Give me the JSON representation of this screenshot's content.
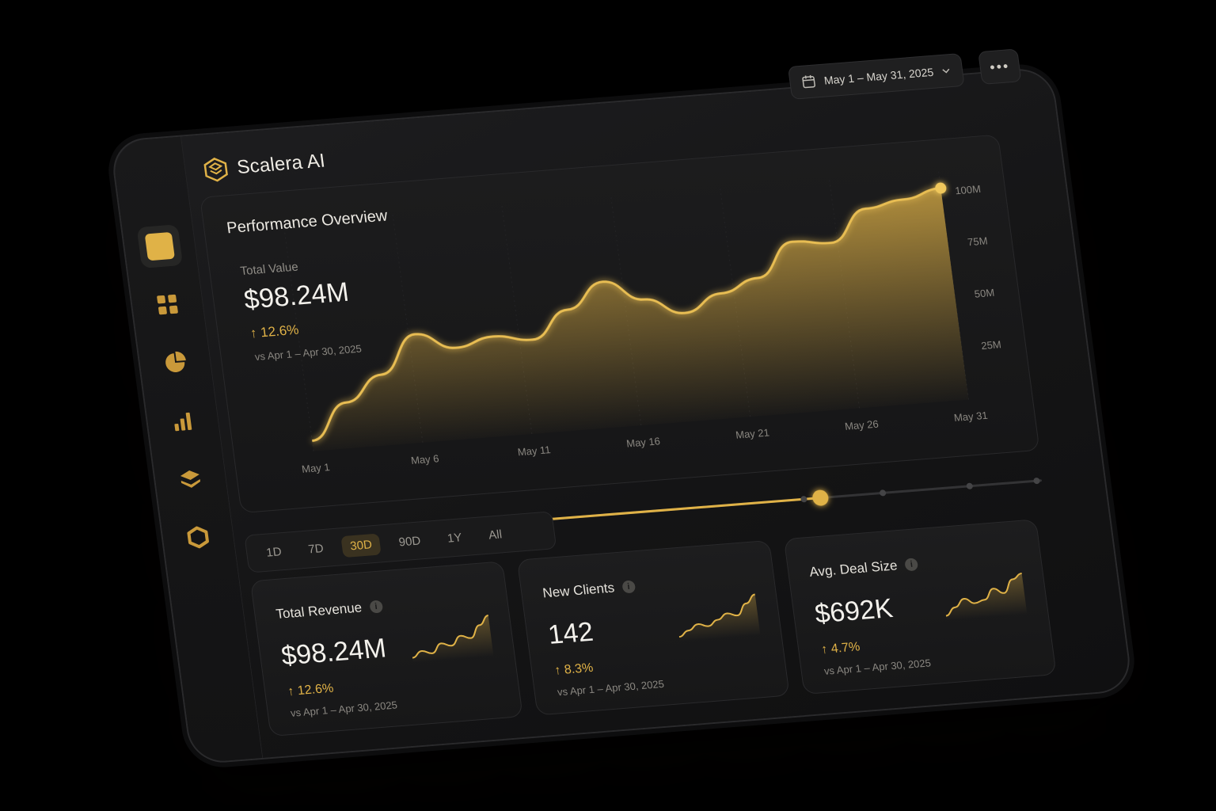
{
  "app": {
    "name": "Scalera AI"
  },
  "header": {
    "date_range": "May 1 – May 31, 2025",
    "more_label": "•••"
  },
  "sidebar": {
    "items": [
      {
        "icon": "home-square-icon",
        "active": true
      },
      {
        "icon": "grid-icon"
      },
      {
        "icon": "pie-chart-icon"
      },
      {
        "icon": "bar-chart-icon"
      },
      {
        "icon": "layers-icon"
      },
      {
        "icon": "hexagon-icon"
      }
    ]
  },
  "overview": {
    "title": "Performance Overview",
    "total_label": "Total Value",
    "total_value": "$98.24M",
    "change": "↑ 12.6%",
    "compare": "vs Apr 1 – Apr 30, 2025"
  },
  "chart_data": {
    "type": "area",
    "x": [
      "May 1",
      "May 3",
      "May 5",
      "May 7",
      "May 9",
      "May 11",
      "May 13",
      "May 14",
      "May 16",
      "May 18",
      "May 19",
      "May 21",
      "May 23",
      "May 24",
      "May 26",
      "May 28",
      "May 30",
      "May 31"
    ],
    "values": [
      5,
      22,
      34,
      52,
      44,
      48,
      45,
      58,
      70,
      60,
      52,
      60,
      66,
      82,
      80,
      95,
      98,
      102
    ],
    "x_ticks": [
      "May 1",
      "May 6",
      "May 11",
      "May 16",
      "May 21",
      "May 26",
      "May 31"
    ],
    "y_ticks": [
      "25M",
      "50M",
      "75M",
      "100M"
    ],
    "ylim": [
      0,
      110
    ],
    "color": "#e0b247",
    "legend": "none",
    "grid": false
  },
  "range": {
    "options": [
      "1D",
      "7D",
      "30D",
      "90D",
      "1Y",
      "All"
    ],
    "selected": "30D"
  },
  "slider": {
    "value": 0.55
  },
  "kpis": [
    {
      "title": "Total Revenue",
      "value": "$98.24M",
      "change": "↑ 12.6%",
      "compare": "vs Apr 1 – Apr 30, 2025",
      "spark": [
        10,
        14,
        12,
        18,
        16,
        22,
        20,
        28,
        34
      ]
    },
    {
      "title": "New Clients",
      "value": "142",
      "change": "↑ 8.3%",
      "compare": "vs Apr 1 – Apr 30, 2025",
      "spark": [
        8,
        12,
        16,
        14,
        18,
        22,
        20,
        28,
        34
      ]
    },
    {
      "title": "Avg. Deal Size",
      "value": "$692K",
      "change": "↑ 4.7%",
      "compare": "vs Apr 1 – Apr 30, 2025",
      "spark": [
        6,
        12,
        18,
        14,
        16,
        24,
        20,
        30,
        34
      ]
    }
  ],
  "colors": {
    "accent": "#e0b247",
    "background": "#141415",
    "card": "#1b1b1c"
  }
}
